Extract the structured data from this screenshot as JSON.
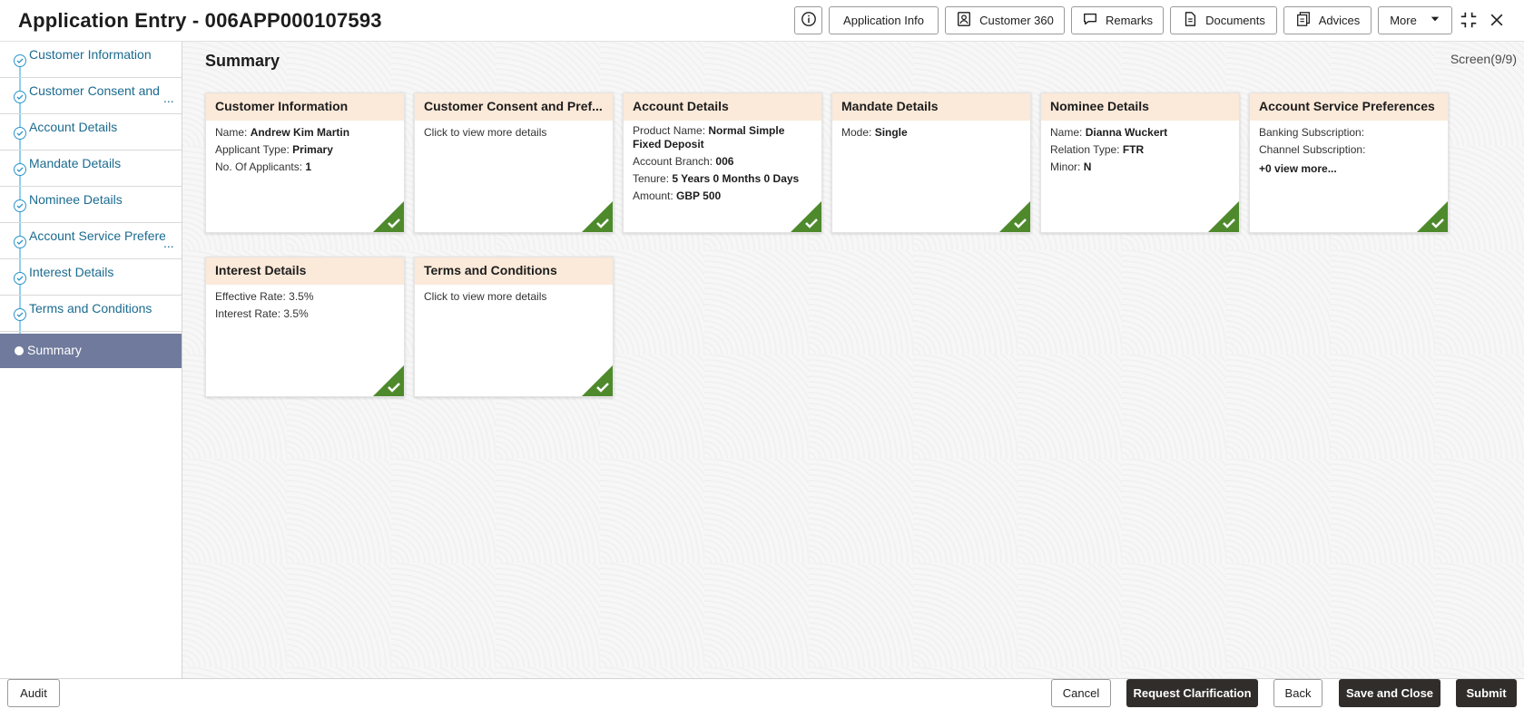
{
  "header": {
    "title": "Application Entry - 006APP000107593",
    "buttons": {
      "application_info": "Application Info",
      "customer_360": "Customer 360",
      "remarks": "Remarks",
      "documents": "Documents",
      "advices": "Advices",
      "more": "More"
    },
    "icons": [
      "info-icon",
      "person-badge-icon",
      "chat-icon",
      "document-icon",
      "advice-icon",
      "chevron-down-icon",
      "collapse-icon",
      "close-icon"
    ]
  },
  "sidebar": {
    "items": [
      {
        "label": "Customer Information",
        "truncated": false
      },
      {
        "label": "Customer Consent and",
        "truncated": true
      },
      {
        "label": "Account Details",
        "truncated": false
      },
      {
        "label": "Mandate Details",
        "truncated": false
      },
      {
        "label": "Nominee Details",
        "truncated": false
      },
      {
        "label": "Account Service Prefere",
        "truncated": true
      },
      {
        "label": "Interest Details",
        "truncated": false
      },
      {
        "label": "Terms and Conditions",
        "truncated": false
      }
    ],
    "ellipsis": "...",
    "active": "Summary"
  },
  "main": {
    "title": "Summary",
    "screen_counter": "Screen(9/9)",
    "cards": {
      "customer_information": {
        "title": "Customer Information",
        "rows": [
          {
            "label": "Name: ",
            "value": "Andrew Kim Martin"
          },
          {
            "label": "Applicant Type: ",
            "value": "Primary"
          },
          {
            "label": "No. Of Applicants: ",
            "value": "1"
          }
        ]
      },
      "customer_consent": {
        "title": "Customer Consent and Pref...",
        "text": "Click to view more details"
      },
      "account_details": {
        "title": "Account Details",
        "rows": [
          {
            "label": "Product Name: ",
            "value": "Normal Simple Fixed Deposit"
          },
          {
            "label": "Account Branch: ",
            "value": "006"
          },
          {
            "label": "Tenure: ",
            "value": "5 Years 0 Months 0 Days"
          },
          {
            "label": "Amount: ",
            "value": "GBP 500"
          }
        ]
      },
      "mandate_details": {
        "title": "Mandate Details",
        "rows": [
          {
            "label": "Mode: ",
            "value": "Single"
          }
        ]
      },
      "nominee_details": {
        "title": "Nominee Details",
        "rows": [
          {
            "label": "Name: ",
            "value": "Dianna Wuckert"
          },
          {
            "label": "Relation Type: ",
            "value": "FTR"
          },
          {
            "label": "Minor: ",
            "value": "N"
          }
        ]
      },
      "account_service_preferences": {
        "title": "Account Service Preferences",
        "rows": [
          {
            "label": "Banking Subscription:",
            "value": ""
          },
          {
            "label": "Channel Subscription:",
            "value": ""
          }
        ],
        "more": "+0 view more..."
      },
      "interest_details": {
        "title": "Interest Details",
        "rows": [
          {
            "label": "Effective Rate: ",
            "value": "3.5%"
          },
          {
            "label": "Interest Rate: ",
            "value": "3.5%"
          }
        ]
      },
      "terms_and_conditions": {
        "title": "Terms and Conditions",
        "text": "Click to view more details"
      }
    },
    "status_color": "#4e8a2c",
    "card_header_color": "#fbe9d9"
  },
  "footer": {
    "audit": "Audit",
    "cancel": "Cancel",
    "request_clarification": "Request Clarification",
    "back": "Back",
    "save_and_close": "Save and Close",
    "submit": "Submit"
  }
}
